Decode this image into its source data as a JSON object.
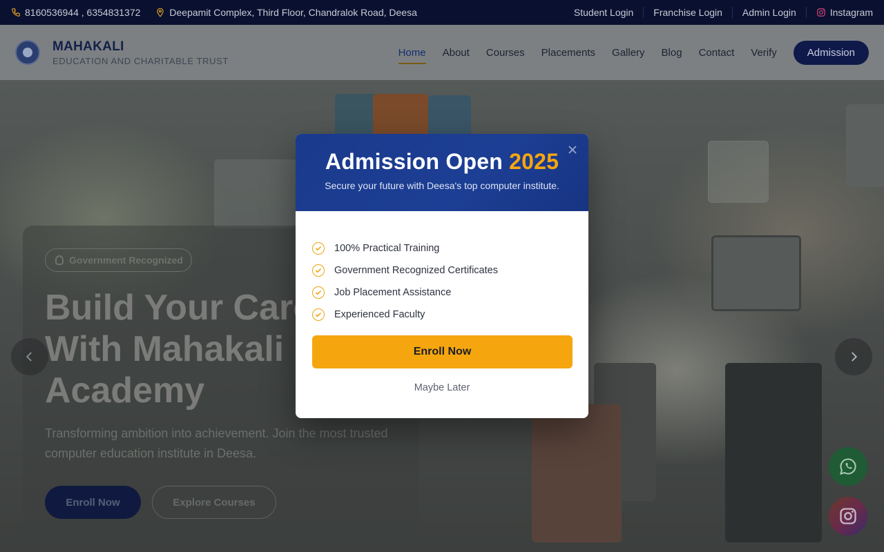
{
  "topbar": {
    "phones": "8160536944 , 6354831372",
    "address": "Deepamit Complex, Third Floor, Chandralok Road, Deesa",
    "links": [
      "Student Login",
      "Franchise Login",
      "Admin Login"
    ],
    "instagram": "Instagram"
  },
  "header": {
    "brand_name": "MAHAKALI",
    "brand_sub": "EDUCATION AND CHARITABLE TRUST",
    "nav": [
      "Home",
      "About",
      "Courses",
      "Placements",
      "Gallery",
      "Blog",
      "Contact",
      "Verify"
    ],
    "cta": "Admission"
  },
  "hero": {
    "badge": "Government Recognized",
    "title_line1": "Build Your Career",
    "title_line2": "With Mahakali",
    "title_line3": "Academy",
    "text": "Transforming ambition into achievement. Join the most trusted computer education institute in Deesa.",
    "enroll": "Enroll Now",
    "explore": "Explore Courses"
  },
  "modal": {
    "title": "Admission Open",
    "year": "2025",
    "subtitle": "Secure your future with Deesa's top computer institute.",
    "features": [
      "100% Practical Training",
      "Government Recognized Certificates",
      "Job Placement Assistance",
      "Experienced Faculty"
    ],
    "enroll": "Enroll Now",
    "later": "Maybe Later"
  },
  "colors": {
    "accent": "#f5a60f",
    "modal_header": "#1c3e94",
    "topbar": "#0a1130"
  }
}
